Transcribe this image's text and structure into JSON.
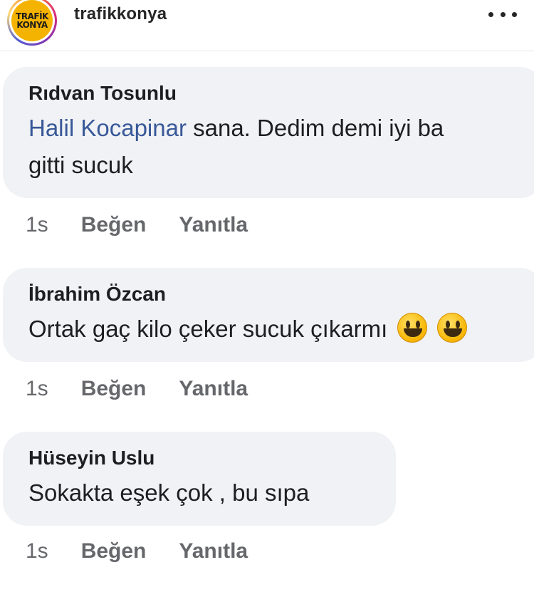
{
  "header": {
    "avatar_text_line1": "TRAFİK",
    "avatar_text_line2": "KONYA",
    "username": "trafikkonya",
    "more_icon": "more-horizontal-icon"
  },
  "comments": [
    {
      "author": "Rıdvan Tosunlu",
      "mention": "Halil Kocapinar",
      "text_after_mention": " sana. Dedim demi iyi ba",
      "text_line2": "gitti sucuk",
      "time": "1s",
      "like_label": "Beğen",
      "reply_label": "Yanıtla"
    },
    {
      "author": "İbrahim Özcan",
      "text": "Ortak gaç kilo çeker sucuk çıkarmı",
      "emoji": "grinning-face-icon",
      "time": "1s",
      "like_label": "Beğen",
      "reply_label": "Yanıtla"
    },
    {
      "author": "Hüseyin Uslu",
      "text": "Sokakta eşek çok , bu sıpa",
      "time": "1s",
      "like_label": "Beğen",
      "reply_label": "Yanıtla"
    }
  ],
  "colors": {
    "bubble_bg": "#f0f2f5",
    "mention": "#385898",
    "meta_text": "#65676b",
    "avatar_bg": "#f5b301"
  }
}
